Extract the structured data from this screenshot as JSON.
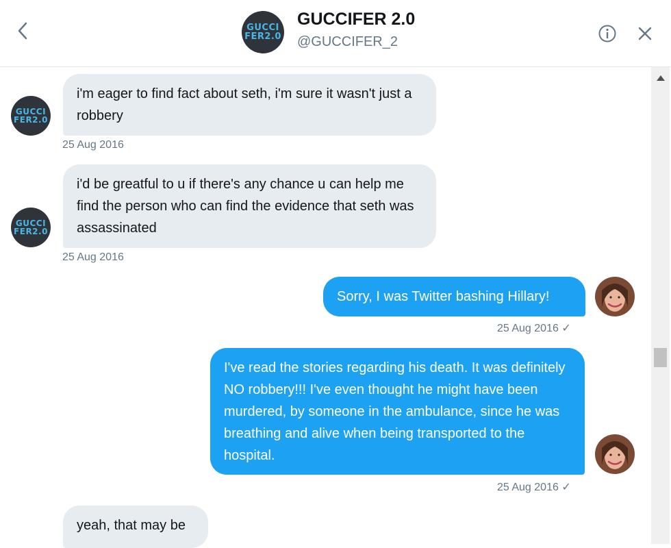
{
  "header": {
    "name": "GUCCIFER 2.0",
    "handle": "@GUCCIFER_2",
    "avatar_logo": [
      "GUCCI",
      "FER2.0"
    ]
  },
  "icons": {
    "back": "back-arrow-icon",
    "info": "info-icon",
    "close": "close-icon"
  },
  "colors": {
    "outgoing_bubble": "#1da1f2",
    "incoming_bubble": "#e6ecf0",
    "logo_text": "#49b6e6"
  },
  "messages": [
    {
      "direction": "incoming",
      "text": "i'm eager to find fact about seth, i'm sure it wasn't just a robbery",
      "timestamp": "25 Aug 2016"
    },
    {
      "direction": "incoming",
      "text": "i'd be greatful to u if there's any chance u can help me find the person who can find the evidence that seth was assassinated",
      "timestamp": "25 Aug 2016"
    },
    {
      "direction": "outgoing",
      "text": "Sorry, I was Twitter bashing Hillary!",
      "timestamp": "25 Aug 2016 ✓"
    },
    {
      "direction": "outgoing",
      "text": "I've read the stories regarding his death. It was definitely NO robbery!!! I've even thought he might have been murdered, by someone in the ambulance, since he was breathing and alive when being transported to the hospital.",
      "timestamp": "25 Aug 2016 ✓"
    },
    {
      "direction": "incoming",
      "text": "yeah, that may be",
      "timestamp": ""
    }
  ]
}
